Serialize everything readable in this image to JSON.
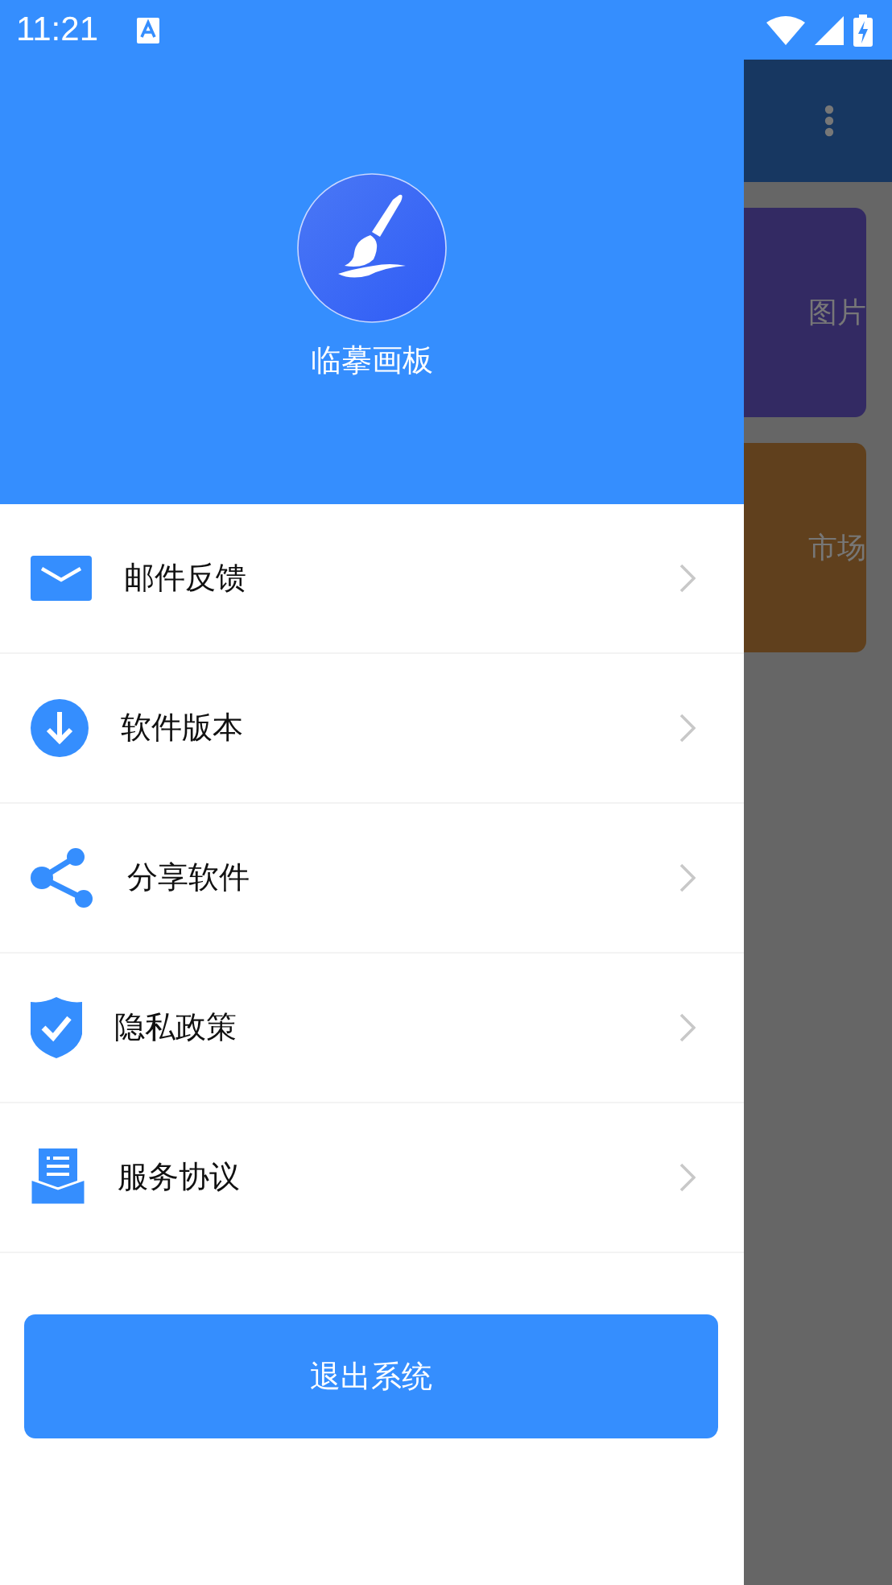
{
  "status_bar": {
    "time": "11:21"
  },
  "background": {
    "cards": [
      {
        "label": "图片",
        "color": "#332a63"
      },
      {
        "label": "市场",
        "color": "#60401d"
      }
    ]
  },
  "drawer": {
    "app_name": "临摹画板",
    "menu_items": [
      {
        "label": "邮件反馈"
      },
      {
        "label": "软件版本"
      },
      {
        "label": "分享软件"
      },
      {
        "label": "隐私政策"
      },
      {
        "label": "服务协议"
      }
    ],
    "button": "退出系统"
  }
}
